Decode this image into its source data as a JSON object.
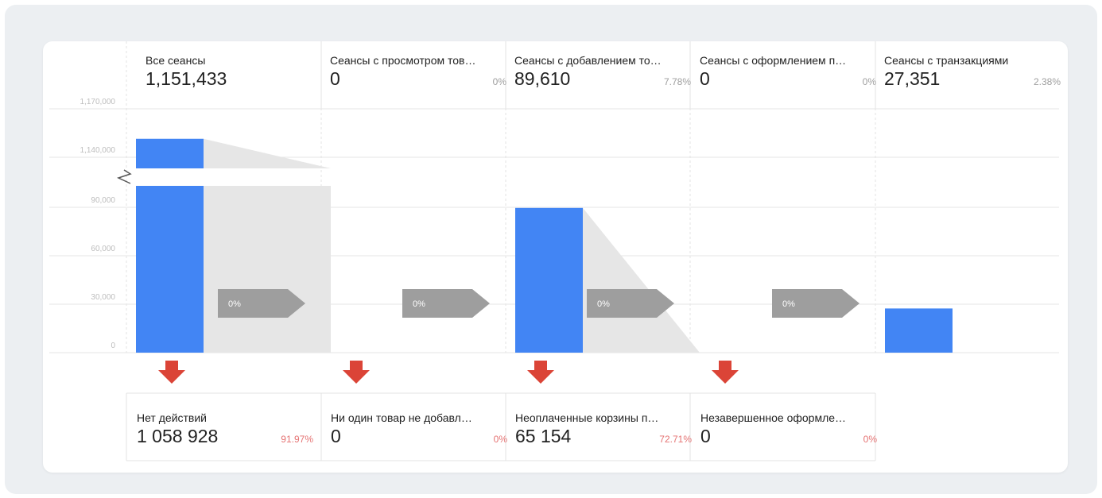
{
  "chart_data": {
    "type": "bar",
    "subtype": "funnel",
    "y_ticks": [
      "0",
      "30,000",
      "60,000",
      "90,000",
      "1,140,000",
      "1,170,000"
    ],
    "axis_break_after": "90,000",
    "categories": [
      "Все сеансы",
      "Сеансы с просмотром тов…",
      "Сеансы с добавлением то…",
      "Сеансы с оформлением п…",
      "Сеансы с транзакциями"
    ],
    "values": [
      1151433,
      0,
      89610,
      0,
      27351
    ],
    "value_labels": [
      "1,151,433",
      "0",
      "89,610",
      "0",
      "27,351"
    ],
    "percentages": [
      "",
      "0%",
      "7.78%",
      "0%",
      "2.38%"
    ],
    "conversion_labels": [
      "0%",
      "0%",
      "0%",
      "0%"
    ],
    "exits": [
      {
        "name": "Нет действий",
        "value_label": "1 058 928",
        "value": 1058928,
        "percent": "91.97%"
      },
      {
        "name": "Ни один товар не добавл…",
        "value_label": "0",
        "value": 0,
        "percent": "0%"
      },
      {
        "name": "Неоплаченные корзины п…",
        "value_label": "65 154",
        "value": 65154,
        "percent": "72.71%"
      },
      {
        "name": "Незавершенное оформле…",
        "value_label": "0",
        "value": 0,
        "percent": "0%"
      }
    ],
    "colors": {
      "bar": "#4285f4",
      "flow": "#e6e6e6",
      "conversion_arrow": "#9e9e9e",
      "exit_arrow": "#db4437",
      "grid": "#e6e6e6",
      "tick_text": "#bdbdbd"
    },
    "grid": true
  }
}
